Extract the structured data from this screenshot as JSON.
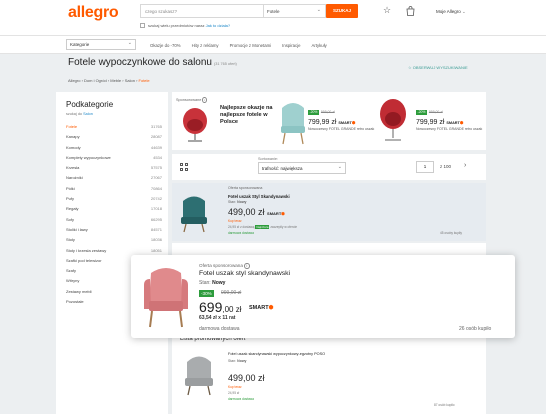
{
  "header": {
    "logo": "allegro",
    "search_placeholder": "czego szukasz?",
    "search_category": "Fotele",
    "search_button": "SZUKAJ",
    "checkbox_label": "szukaj wielu przedmiotów naraz",
    "checkbox_link": "Jak to działa?",
    "account_label": "Moje Allegro"
  },
  "nav": {
    "category_select": "Kategorie",
    "links": [
      "Okazje do -70%",
      "Hity z reklamy",
      "Promocje z Monetami",
      "Inspiracje",
      "Artykuły"
    ]
  },
  "page": {
    "title": "Fotele wypoczynkowe do salonu",
    "count": "(31 765 ofert)",
    "breadcrumb": [
      "Allegro",
      "Dom i Ogród",
      "Meble",
      "Salon"
    ],
    "breadcrumb_current": "Fotele",
    "follow": "OBSERWUJ WYSZUKIWANIE"
  },
  "sidebar": {
    "title": "Podkategorie",
    "subtitle_prefix": "szukaj do",
    "subtitle_link": "Salon",
    "items": [
      {
        "name": "Fotele",
        "count": "31765"
      },
      {
        "name": "Kanapy",
        "count": "28087"
      },
      {
        "name": "Komody",
        "count": "44639"
      },
      {
        "name": "Komplety wypoczynkowe",
        "count": "4534"
      },
      {
        "name": "Krzesła",
        "count": "57575"
      },
      {
        "name": "Narożniki",
        "count": "27067"
      },
      {
        "name": "Półki",
        "count": "70864"
      },
      {
        "name": "Pufy",
        "count": "20742"
      },
      {
        "name": "Regały",
        "count": "17018"
      },
      {
        "name": "Sofy",
        "count": "66295"
      },
      {
        "name": "Stoliki i ławy",
        "count": "84571"
      },
      {
        "name": "Stoły",
        "count": "18036"
      },
      {
        "name": "Stoły i krzesła zestawy",
        "count": "18051"
      },
      {
        "name": "Szafki pod telewizor",
        "count": "46320"
      },
      {
        "name": "Szafy",
        "count": ""
      },
      {
        "name": "Witryny",
        "count": ""
      },
      {
        "name": "Zestawy mebli",
        "count": ""
      },
      {
        "name": "Pozostałe",
        "count": ""
      }
    ]
  },
  "sponsored": {
    "label": "Sponsorowane",
    "headline": "Najlepsze okazje na najlepsze fotele w Polsce",
    "offers": [
      {
        "badge": "-20%",
        "old": "999,00 zł",
        "price": "799,99 zł",
        "smart": "SMART",
        "name": "Nowoczesny FOTEL GRANDE retro uszak"
      },
      {
        "badge": "-20%",
        "old": "999,00 zł",
        "price": "799,99 zł",
        "smart": "SMART",
        "name": "Nowoczesny FOTEL GRANDE retro uszak"
      }
    ]
  },
  "toolbar": {
    "sort_label": "Sortowanie:",
    "sort_value": "trafność: największa",
    "page_current": "1",
    "page_total": "z 100"
  },
  "listing1": {
    "sponsored_label": "Oferta sponsorowana",
    "name": "Fotel uszak Styl Skandynawski",
    "state_label": "Stan:",
    "state_value": "Nowy",
    "price": "499,00 zł",
    "smart": "SMART",
    "extra1": "Kup teraz",
    "extra2": "24,95 zł",
    "extra3": "z dostawą",
    "chip": "Najniższa",
    "extra4": "zaczepiły w ofercie",
    "delivery": "darmowa dostawa",
    "sold": "45 osoby kupiły"
  },
  "promo": {
    "title": "Lista promowanych ofert",
    "name": "Fotel uszak skandynawski wypoczynkowy-egzotny POSO",
    "state_label": "Stan:",
    "state_value": "Nowy",
    "price": "499,00 zł",
    "extra1": "Kup teraz",
    "extra2": "24,95 zł",
    "delivery": "darmowa dostawa",
    "sold": "87 osób kupiło"
  },
  "card": {
    "sponsored_label": "Oferta sponsorowana",
    "name": "Fotel uszak styl skandynawski",
    "state_label": "Stan:",
    "state_value": "Nowy",
    "badge": "-30%",
    "old_price": "999,00 zł",
    "price_main": "699",
    "price_rest": ",00 zł",
    "smart": "SMART",
    "installments": "63,54 zł x 11 rat",
    "delivery": "darmowa dostawa",
    "sold": "26 osób kupiło"
  },
  "colors": {
    "accent": "#ff5a00",
    "green": "#2d9c3c",
    "link": "#1e88c8",
    "teal": "#3a9c94"
  },
  "icons": [
    "star-icon",
    "bag-icon",
    "bell-icon",
    "info-icon",
    "grid-view-icon",
    "chevron-right-icon"
  ]
}
